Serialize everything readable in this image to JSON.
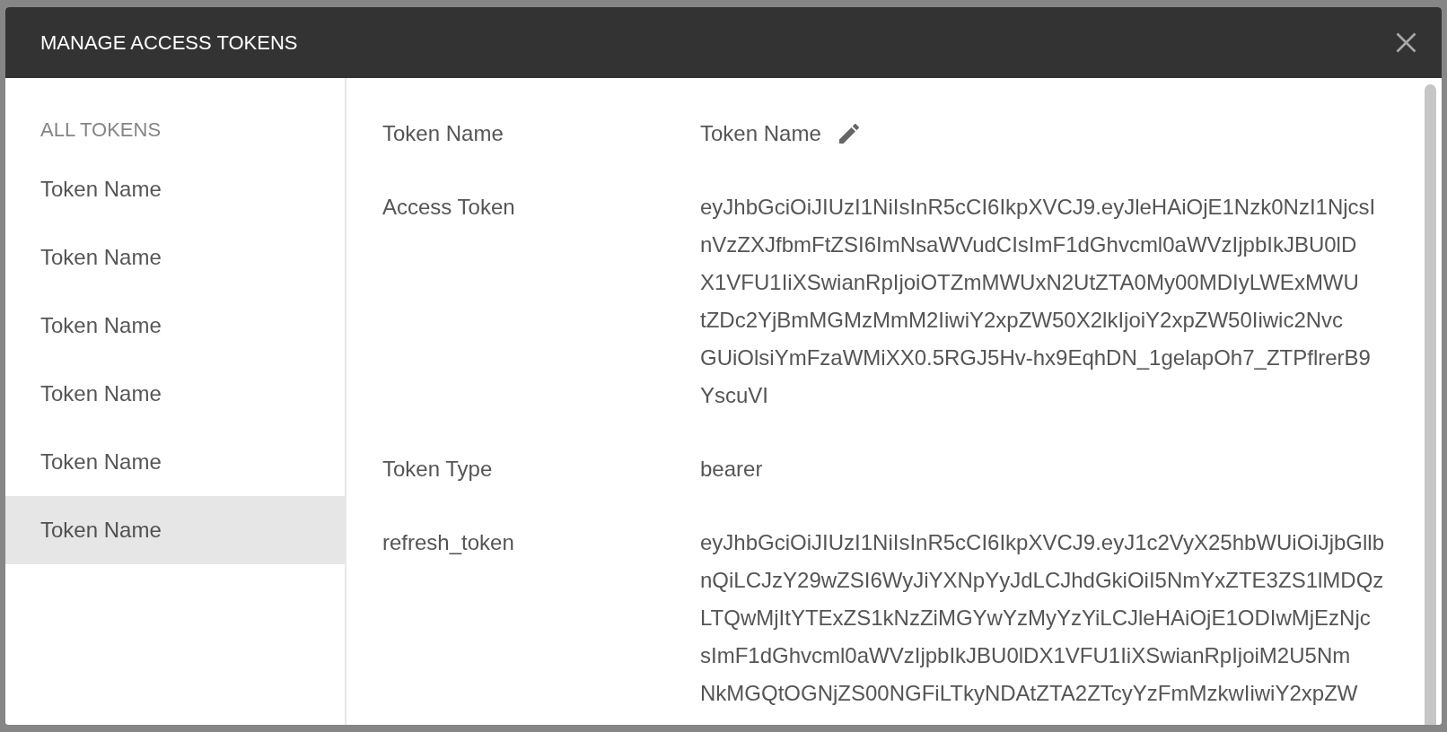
{
  "dialog": {
    "title": "MANAGE ACCESS TOKENS"
  },
  "sidebar": {
    "heading": "ALL TOKENS",
    "items": [
      {
        "label": "Token Name",
        "selected": false
      },
      {
        "label": "Token Name",
        "selected": false
      },
      {
        "label": "Token Name",
        "selected": false
      },
      {
        "label": "Token Name",
        "selected": false
      },
      {
        "label": "Token Name",
        "selected": false
      },
      {
        "label": "Token Name",
        "selected": true
      }
    ]
  },
  "details": {
    "fields": [
      {
        "kind": "editable",
        "label": "Token Name",
        "value": "Token Name"
      },
      {
        "kind": "multiline",
        "label": "Access Token",
        "lines": [
          "eyJhbGciOiJIUzI1NiIsInR5cCI6IkpXVCJ9.eyJleHAiOjE1Nzk0NzI1NjcsI",
          "nVzZXJfbmFtZSI6ImNsaWVudCIsImF1dGhvcml0aWVzIjpbIkJBU0lD",
          "X1VFU1IiXSwianRpIjoiOTZmMWUxN2UtZTA0My00MDIyLWExMWU",
          "tZDc2YjBmMGMzMmM2IiwiY2xpZW50X2lkIjoiY2xpZW50Iiwic2Nvc",
          "GUiOlsiYmFzaWMiXX0.5RGJ5Hv-hx9EqhDN_1gelapOh7_ZTPflrerB9",
          "YscuVI"
        ]
      },
      {
        "kind": "text",
        "label": "Token Type",
        "value": "bearer"
      },
      {
        "kind": "multiline",
        "label": "refresh_token",
        "lines": [
          "eyJhbGciOiJIUzI1NiIsInR5cCI6IkpXVCJ9.eyJ1c2VyX25hbWUiOiJjbGllb",
          "nQiLCJzY29wZSI6WyJiYXNpYyJdLCJhdGkiOiI5NmYxZTE3ZS1lMDQz",
          "LTQwMjItYTExZS1kNzZiMGYwYzMyYzYiLCJleHAiOjE1ODIwMjEzNjc",
          "sImF1dGhvcml0aWVzIjpbIkJBU0lDX1VFU1IiXSwianRpIjoiM2U5Nm",
          "NkMGQtOGNjZS00NGFiLTkyNDAtZTA2ZTcyYzFmMzkwIiwiY2xpZW"
        ]
      }
    ]
  }
}
